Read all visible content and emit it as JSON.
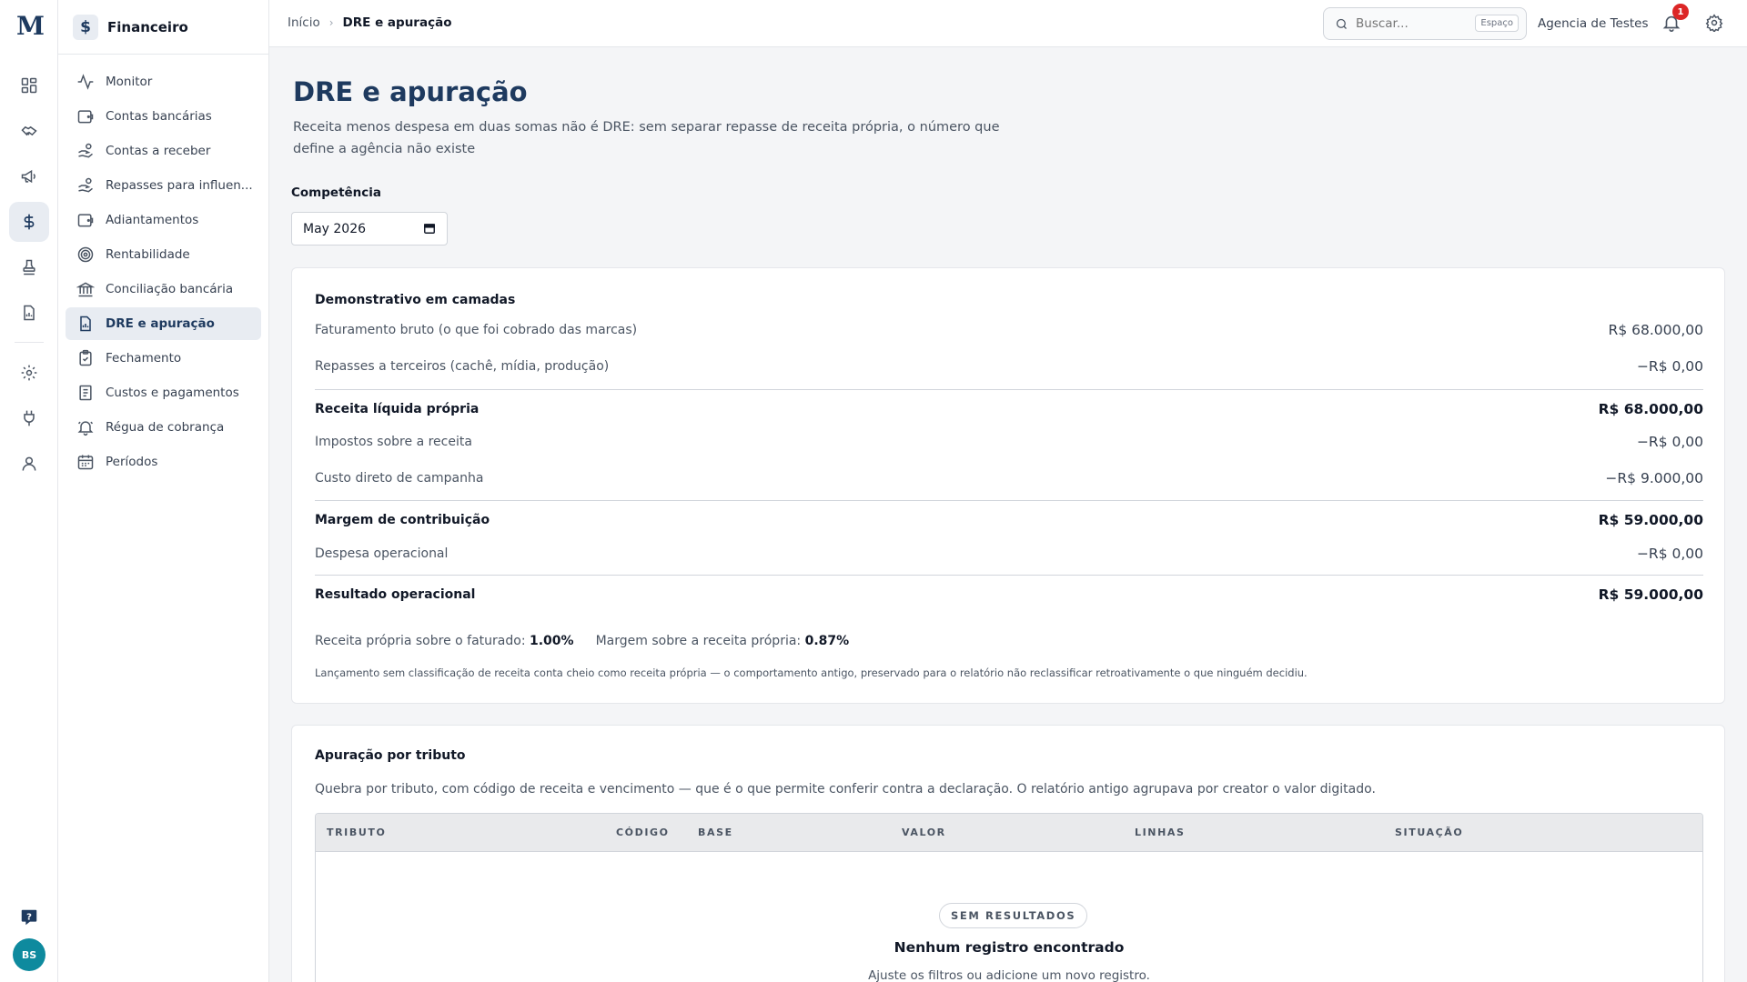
{
  "rail": {
    "logo": "M",
    "avatar_initials": "BS",
    "items": [
      "dashboard-icon",
      "handshake-icon",
      "megaphone-icon",
      "dollar-icon",
      "stamp-icon",
      "report-icon",
      "gear-icon",
      "plug-icon",
      "user-icon"
    ]
  },
  "subnav": {
    "title": "Financeiro",
    "items": [
      {
        "label": "Monitor",
        "icon": "activity-icon"
      },
      {
        "label": "Contas bancárias",
        "icon": "wallet-icon"
      },
      {
        "label": "Contas a receber",
        "icon": "hand-coins-icon"
      },
      {
        "label": "Repasses para influen...",
        "icon": "hand-coins-icon"
      },
      {
        "label": "Adiantamentos",
        "icon": "wallet-icon"
      },
      {
        "label": "Rentabilidade",
        "icon": "target-icon"
      },
      {
        "label": "Conciliação bancária",
        "icon": "bank-icon"
      },
      {
        "label": "DRE e apuração",
        "icon": "file-chart-icon",
        "active": true
      },
      {
        "label": "Fechamento",
        "icon": "clipboard-check-icon"
      },
      {
        "label": "Custos e pagamentos",
        "icon": "receipt-icon"
      },
      {
        "label": "Régua de cobrança",
        "icon": "bell-ring-icon"
      },
      {
        "label": "Períodos",
        "icon": "calendar-icon"
      }
    ]
  },
  "topbar": {
    "breadcrumb_home": "Início",
    "breadcrumb_current": "DRE e apuração",
    "search_placeholder": "Buscar...",
    "search_shortcut": "Espaço",
    "org_name": "Agencia de Testes",
    "notification_count": "1"
  },
  "page": {
    "title": "DRE e apuração",
    "subtitle": "Receita menos despesa em duas somas não é DRE: sem separar repasse de receita própria, o número que define a agência não existe",
    "competencia_label": "Competência",
    "competencia_value": "May 2026"
  },
  "dre": {
    "title": "Demonstrativo em camadas",
    "rows": [
      {
        "label": "Faturamento bruto (o que foi cobrado das marcas)",
        "value": "R$ 68.000,00",
        "total": false
      },
      {
        "label": "Repasses a terceiros (cachê, mídia, produção)",
        "value": "−R$ 0,00",
        "total": false
      },
      {
        "label": "Receita líquida própria",
        "value": "R$ 68.000,00",
        "total": true
      },
      {
        "label": "Impostos sobre a receita",
        "value": "−R$ 0,00",
        "total": false
      },
      {
        "label": "Custo direto de campanha",
        "value": "−R$ 9.000,00",
        "total": false
      },
      {
        "label": "Margem de contribuição",
        "value": "R$ 59.000,00",
        "total": true
      },
      {
        "label": "Despesa operacional",
        "value": "−R$ 0,00",
        "total": false
      },
      {
        "label": "Resultado operacional",
        "value": "R$ 59.000,00",
        "total": true
      }
    ],
    "ratio1_label": "Receita própria sobre o faturado:",
    "ratio1_value": "1.00%",
    "ratio2_label": "Margem sobre a receita própria:",
    "ratio2_value": "0.87%",
    "footnote": "Lançamento sem classificação de receita conta cheio como receita própria — o comportamento antigo, preservado para o relatório não reclassificar retroativamente o que ninguém decidiu."
  },
  "apuracao": {
    "title": "Apuração por tributo",
    "subtitle": "Quebra por tributo, com código de receita e vencimento — que é o que permite conferir contra a declaração. O relatório antigo agrupava por creator o valor digitado.",
    "columns": [
      "TRIBUTO",
      "CÓDIGO",
      "BASE",
      "VALOR",
      "LINHAS",
      "SITUAÇÃO"
    ],
    "empty_badge": "SEM RESULTADOS",
    "empty_title": "Nenhum registro encontrado",
    "empty_sub": "Ajuste os filtros ou adicione um novo registro."
  }
}
